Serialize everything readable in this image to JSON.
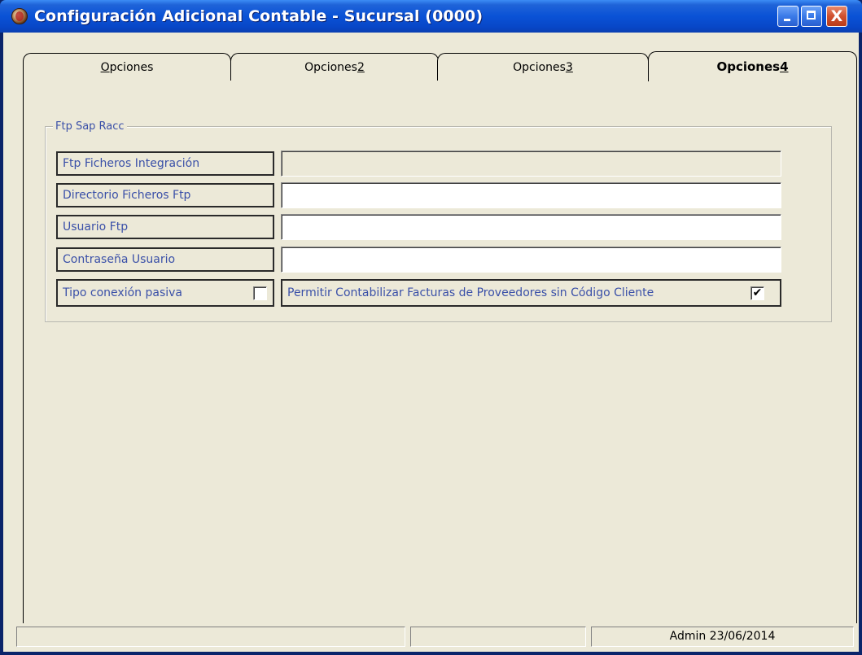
{
  "window": {
    "title": "Configuración Adicional Contable - Sucursal (0000)",
    "close_glyph": "X"
  },
  "tabs": [
    {
      "hotkey": "O",
      "rest": "pciones"
    },
    {
      "prefix": "Opciones",
      "hotkey": "2"
    },
    {
      "prefix": "Opciones",
      "hotkey": "3"
    },
    {
      "prefix": "Opciones",
      "hotkey": "4"
    }
  ],
  "active_tab_index": 3,
  "group": {
    "legend": "Ftp Sap Racc",
    "rows": [
      {
        "label": "Ftp Ficheros Integración",
        "value": "",
        "disabled": true
      },
      {
        "label": "Directorio Ficheros Ftp",
        "value": "",
        "disabled": false
      },
      {
        "label": "Usuario Ftp",
        "value": "",
        "disabled": false
      },
      {
        "label": "Contraseña Usuario",
        "value": "",
        "disabled": false
      }
    ],
    "passive_connection": {
      "label": "Tipo conexión pasiva",
      "checked": false
    },
    "allow_invoices": {
      "label": "Permitir Contabilizar Facturas de Proveedores sin Código Cliente",
      "checked": true,
      "check_glyph": "✔"
    }
  },
  "statusbar": {
    "panel1": "",
    "panel2": "",
    "panel3": "Admin 23/06/2014"
  },
  "colors": {
    "label_text": "#3a50a8",
    "titlebar": "#0a52d6",
    "background": "#ece9d8"
  }
}
